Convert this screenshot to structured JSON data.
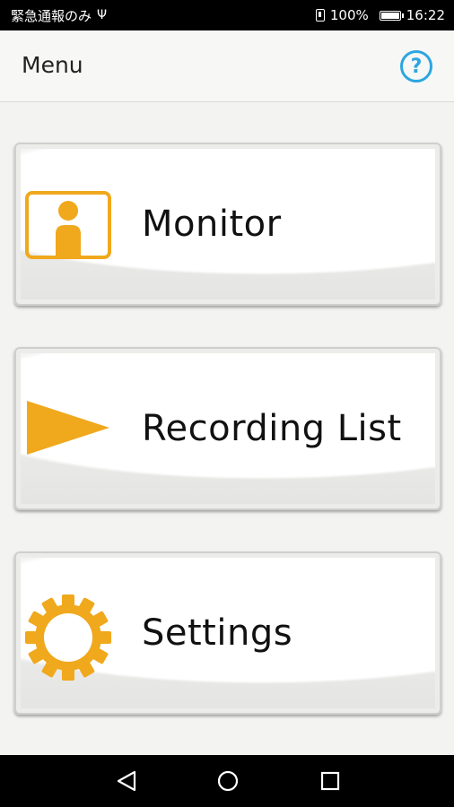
{
  "status_bar": {
    "left_text": "緊急通報のみ",
    "battery_percent": "100%",
    "time": "16:22"
  },
  "header": {
    "title": "Menu",
    "help_label": "?"
  },
  "menu": {
    "items": [
      {
        "label": "Monitor",
        "icon": "monitor-icon"
      },
      {
        "label": "Recording List",
        "icon": "play-icon"
      },
      {
        "label": "Settings",
        "icon": "gear-icon"
      }
    ]
  },
  "colors": {
    "accent_orange": "#f0a81c",
    "help_blue": "#2aa6e0"
  },
  "nav_bar": {
    "buttons": [
      "back",
      "home",
      "recent-apps"
    ]
  }
}
